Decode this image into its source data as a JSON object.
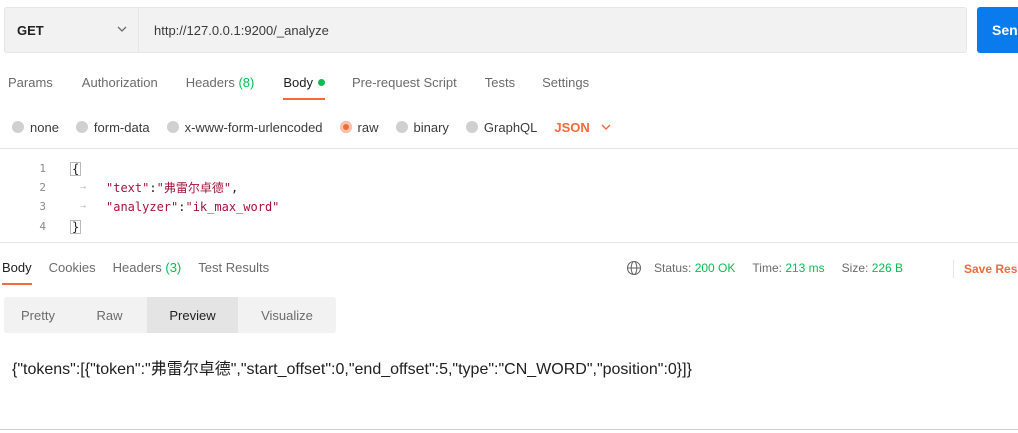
{
  "request": {
    "method": "GET",
    "url": "http://127.0.0.1:9200/_analyze",
    "send_label": "Send"
  },
  "request_tabs": [
    {
      "label": "Params"
    },
    {
      "label": "Authorization"
    },
    {
      "label": "Headers",
      "count": "(8)"
    },
    {
      "label": "Body"
    },
    {
      "label": "Pre-request Script"
    },
    {
      "label": "Tests"
    },
    {
      "label": "Settings"
    }
  ],
  "body_types": [
    {
      "label": "none"
    },
    {
      "label": "form-data"
    },
    {
      "label": "x-www-form-urlencoded"
    },
    {
      "label": "raw"
    },
    {
      "label": "binary"
    },
    {
      "label": "GraphQL"
    }
  ],
  "format_select": "JSON",
  "editor": {
    "lines": [
      {
        "num": "1",
        "brace": "{"
      },
      {
        "num": "2",
        "key": "\"text\"",
        "colon": ":",
        "value": "\"弗雷尔卓德\"",
        "trail": ","
      },
      {
        "num": "3",
        "key": "\"analyzer\"",
        "colon": ":",
        "value": "\"ik_max_word\"",
        "trail": ""
      },
      {
        "num": "4",
        "brace": "}"
      }
    ]
  },
  "response_tabs": [
    {
      "label": "Body"
    },
    {
      "label": "Cookies"
    },
    {
      "label": "Headers",
      "count": "(3)"
    },
    {
      "label": "Test Results"
    }
  ],
  "status": {
    "status_label": "Status:",
    "status_value": "200 OK",
    "time_label": "Time:",
    "time_value": "213 ms",
    "size_label": "Size:",
    "size_value": "226 B",
    "save_label": "Save Response"
  },
  "view_tabs": [
    {
      "label": "Pretty"
    },
    {
      "label": "Raw"
    },
    {
      "label": "Preview"
    },
    {
      "label": "Visualize"
    }
  ],
  "preview_text": "{\"tokens\":[{\"token\":\"弗雷尔卓德\",\"start_offset\":0,\"end_offset\":5,\"type\":\"CN_WORD\",\"position\":0}]}",
  "colors": {
    "accent": "#f26b3a",
    "send": "#097bed",
    "success": "#0cbb52",
    "json_key": "#a4143c"
  },
  "icons": {
    "method_dropdown": "chevron-down-icon",
    "format_dropdown": "chevron-down-icon",
    "status_globe": "globe-icon"
  }
}
